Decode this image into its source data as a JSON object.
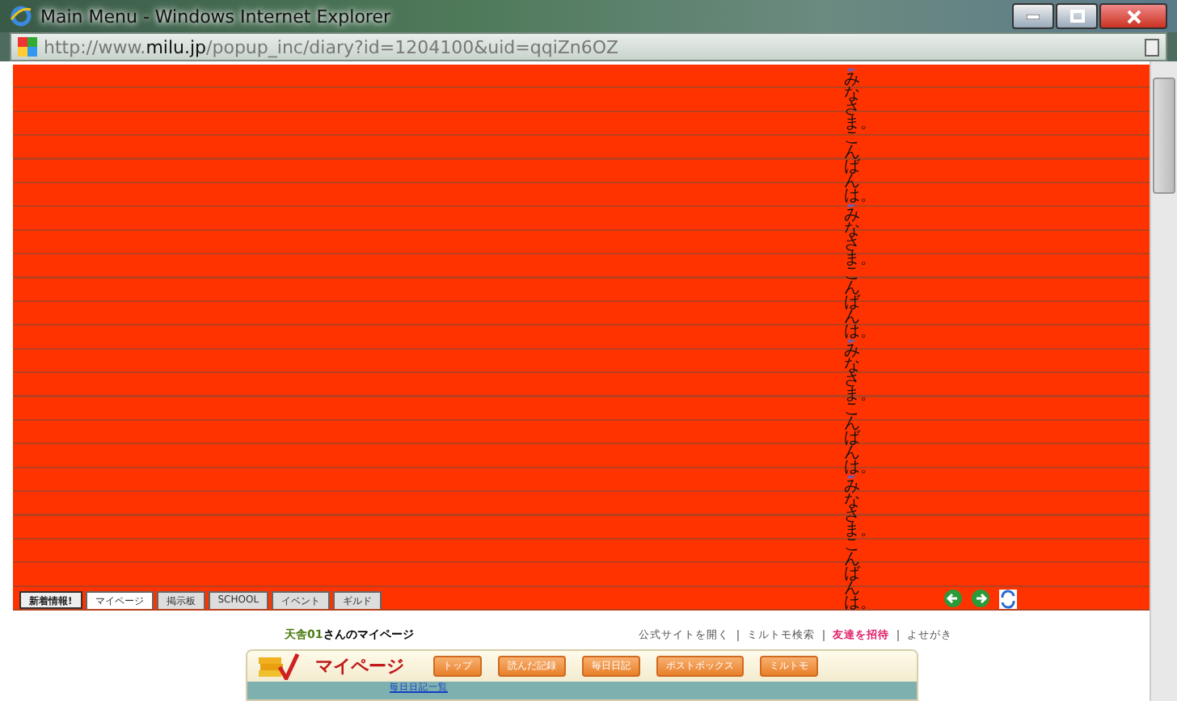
{
  "window": {
    "title": "Main Menu - Windows Internet Explorer"
  },
  "address_bar": {
    "url": "http://www.**milu.jp**/popup_inc/diary?id=1204100&uid=qqiZn6OZ"
  },
  "diary": {
    "messages": [
      {
        "text": "みなさま。こんばんは。"
      },
      {
        "text": "みなさま。こんばんは。"
      },
      {
        "text": "みなさま。こんばんは。"
      },
      {
        "text": "みなさま。こんばんは。"
      }
    ]
  },
  "tabs": [
    {
      "label": "新着情報!",
      "kind": "notice",
      "selected": false
    },
    {
      "label": "マイページ",
      "kind": "tab",
      "selected": true
    },
    {
      "label": "掲示板",
      "kind": "tab",
      "selected": false
    },
    {
      "label": "SCHOOL",
      "kind": "tab",
      "selected": false
    },
    {
      "label": "イベント",
      "kind": "tab",
      "selected": false
    },
    {
      "label": "ギルド",
      "kind": "tab",
      "selected": false
    }
  ],
  "mypage": {
    "owner": "天舎01",
    "title_suffix": "さんのマイページ",
    "links": [
      {
        "label": "公式サイトを開く",
        "highlighted": false
      },
      {
        "label": "ミルトモ検索",
        "highlighted": false
      },
      {
        "label": "友達を招待",
        "highlighted": true
      },
      {
        "label": "よせがき",
        "highlighted": false
      }
    ],
    "banner_title": "マイページ",
    "buttons": [
      "トップ",
      "読んだ記録",
      "毎日日記",
      "ポストボックス",
      "ミルトモ"
    ],
    "sub_link": "毎日日記一覧"
  }
}
